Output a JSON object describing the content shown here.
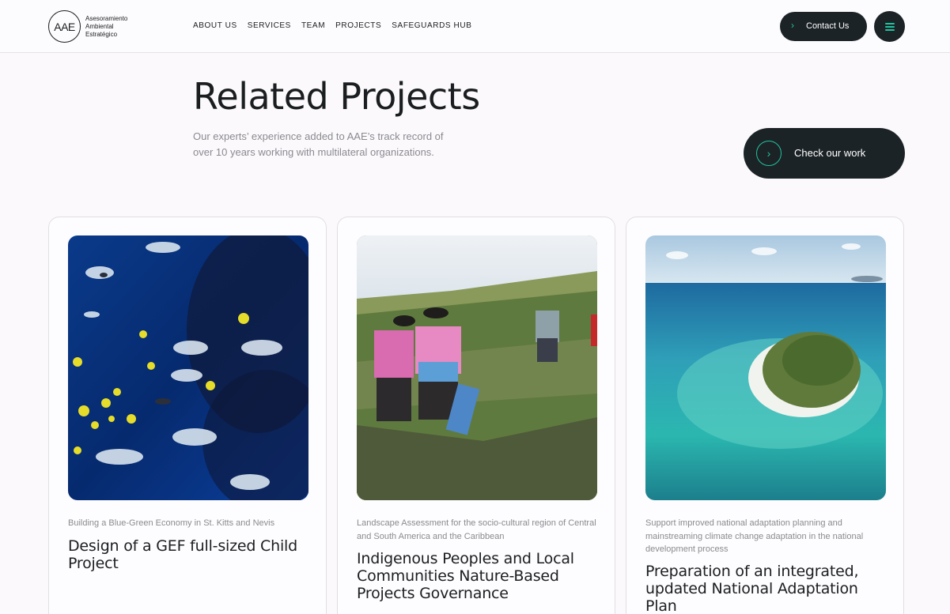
{
  "brand": {
    "logo_mark": "AAE",
    "logo_lines": [
      "Asesoramiento",
      "Ambiental",
      "Estratégico"
    ]
  },
  "nav": {
    "items": [
      "ABOUT US",
      "SERVICES",
      "TEAM",
      "PROJECTS",
      "SAFEGUARDS HUB"
    ]
  },
  "header": {
    "contact_label": "Contact Us",
    "contact_icon": "chevron-right-icon",
    "menu_icon": "hamburger-menu-icon"
  },
  "hero": {
    "title": "Related Projects",
    "description": "Our experts’ experience added to AAE’s track record of over 10 years working with multilateral organizations.",
    "cta_label": "Check our work",
    "cta_icon": "chevron-right-icon"
  },
  "projects": [
    {
      "subtitle": "Building a Blue-Green Economy in St. Kitts and Nevis",
      "title": "Design of a GEF full-sized Child Project",
      "image": "aquarium-fish-photo"
    },
    {
      "subtitle": "Landscape Assessment for the socio-cultural region of Central and South America and the Caribbean",
      "title": "Indigenous Peoples and Local Communities Nature-Based Projects Governance",
      "image": "indigenous-women-walking-photo"
    },
    {
      "subtitle": "Support improved national adaptation planning and mainstreaming climate change adaptation in the national development process",
      "title": "Preparation of an integrated, updated National Adaptation Plan",
      "image": "tropical-island-aerial-photo"
    }
  ],
  "colors": {
    "dark": "#1c2326",
    "accent": "#1fc3a0",
    "muted_text": "#8b8a8f",
    "background": "#fbf9fc"
  }
}
